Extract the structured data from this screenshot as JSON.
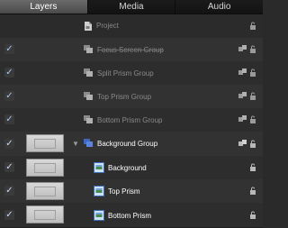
{
  "tabs": [
    {
      "label": "Layers",
      "active": true
    },
    {
      "label": "Media",
      "active": false
    },
    {
      "label": "Audio",
      "active": false
    }
  ],
  "project": {
    "label": "Project",
    "icon": "project-document-icon",
    "lock": "lock-icon"
  },
  "groups": [
    {
      "label": "Focus Screen Group",
      "checked": true,
      "dimmed": true,
      "strike": true,
      "icon": "group-icon"
    },
    {
      "label": "Split Prism Group",
      "checked": true,
      "dimmed": true,
      "icon": "group-icon"
    },
    {
      "label": "Top Prism Group",
      "checked": true,
      "dimmed": true,
      "icon": "group-icon"
    },
    {
      "label": "Bottom Prism Group",
      "checked": true,
      "dimmed": true,
      "icon": "group-icon"
    },
    {
      "label": "Background Group",
      "checked": true,
      "dimmed": false,
      "icon": "group-icon",
      "expanded": true
    }
  ],
  "layers": [
    {
      "label": "Background",
      "checked": true,
      "icon": "image-layer-icon"
    },
    {
      "label": "Top Prism",
      "checked": true,
      "icon": "image-layer-icon"
    },
    {
      "label": "Bottom Prism",
      "checked": true,
      "icon": "image-layer-icon"
    }
  ],
  "colors": {
    "check": "#a9c7f2",
    "active_tab": "#5a5a5a",
    "group_icon": "#4a7bd8"
  }
}
